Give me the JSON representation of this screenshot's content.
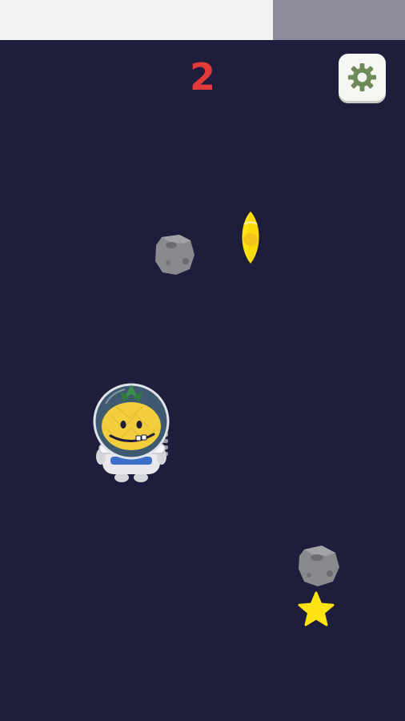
{
  "hud": {
    "score": "2",
    "settings_icon": "gear-icon"
  },
  "colors": {
    "background": "#1e1d3b",
    "score": "#e33a3a",
    "settings_button": "#f6f6f2",
    "gear": "#6f8a5a",
    "asteroid": "#8a8a8e",
    "star": "#ffe313",
    "rocket": "#ffe313"
  },
  "sprites": {
    "player": "astronaut-pineapple-character",
    "obstacles": [
      "asteroid",
      "asteroid"
    ],
    "pickups": [
      "rocket",
      "star"
    ]
  }
}
